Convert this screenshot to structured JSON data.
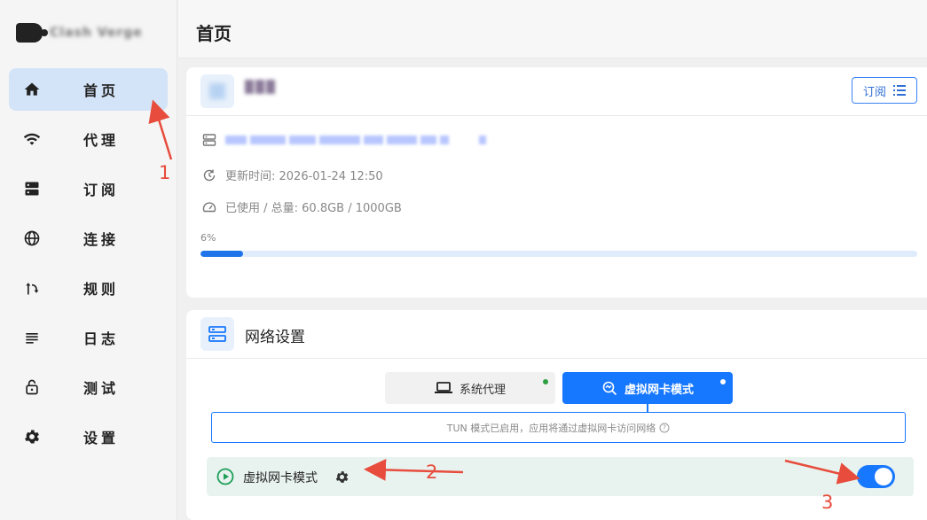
{
  "app": {
    "name": "Clash Verge"
  },
  "sidebar": {
    "items": [
      {
        "label": "首页",
        "icon": "home-icon",
        "active": true
      },
      {
        "label": "代理",
        "icon": "wifi-icon"
      },
      {
        "label": "订阅",
        "icon": "server-icon"
      },
      {
        "label": "连接",
        "icon": "globe-icon"
      },
      {
        "label": "规则",
        "icon": "fork-icon"
      },
      {
        "label": "日志",
        "icon": "lines-icon"
      },
      {
        "label": "测试",
        "icon": "lock-icon"
      },
      {
        "label": "设置",
        "icon": "gear-icon"
      }
    ]
  },
  "header": {
    "title": "首页"
  },
  "subscription": {
    "button_label": "订阅",
    "updated": "更新时间: 2026-01-24 12:50",
    "usage": "已使用 / 总量: 60.8GB / 1000GB",
    "percent_label": "6%",
    "progress": 0.06
  },
  "network": {
    "title": "网络设置",
    "modes": [
      {
        "label": "系统代理",
        "status_color": "#2ea043"
      },
      {
        "label": "虚拟网卡模式",
        "active": true,
        "status_color": "#ffffff"
      }
    ],
    "note": "TUN 模式已启用，应用将通过虚拟网卡访问网络",
    "tun_row_label": "虚拟网卡模式",
    "tun_enabled": true
  },
  "annotations": {
    "a1": "1",
    "a2": "2",
    "a3": "3"
  },
  "colors": {
    "accent": "#1677ff",
    "annotation": "#e74c3c",
    "active_nav": "#d3e3f8"
  }
}
